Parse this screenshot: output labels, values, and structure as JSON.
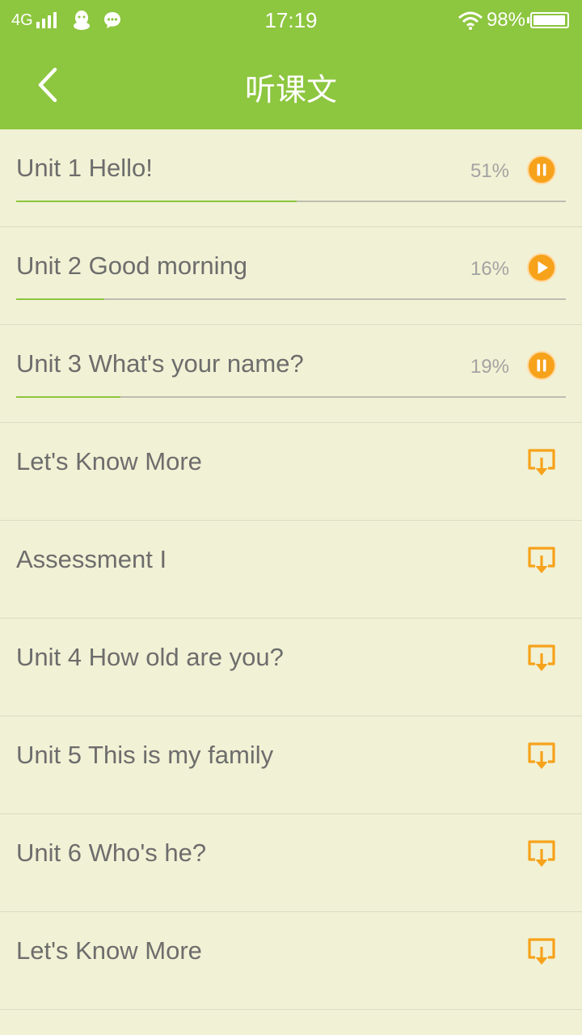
{
  "status_bar": {
    "network": "4G",
    "time": "17:19",
    "battery": "98%",
    "battery_level": 0.98
  },
  "header": {
    "title": "听课文"
  },
  "colors": {
    "header_bg": "#8dc63f",
    "list_bg": "#f1f1d5",
    "accent_orange": "#f7a21b",
    "progress_fill": "#8dc63f"
  },
  "items": [
    {
      "title": "Unit 1 Hello!",
      "percent": "51%",
      "progress": 0.51,
      "action": "pause-icon"
    },
    {
      "title": "Unit 2 Good morning",
      "percent": "16%",
      "progress": 0.16,
      "action": "play-icon"
    },
    {
      "title": "Unit 3 What's your name?",
      "percent": "19%",
      "progress": 0.19,
      "action": "pause-icon"
    },
    {
      "title": "Let's Know More",
      "action": "download-icon"
    },
    {
      "title": "Assessment I",
      "action": "download-icon"
    },
    {
      "title": "Unit 4 How old are you?",
      "action": "download-icon"
    },
    {
      "title": "Unit 5 This is my family",
      "action": "download-icon"
    },
    {
      "title": "Unit 6 Who's he?",
      "action": "download-icon"
    },
    {
      "title": "Let's Know More",
      "action": "download-icon"
    }
  ]
}
